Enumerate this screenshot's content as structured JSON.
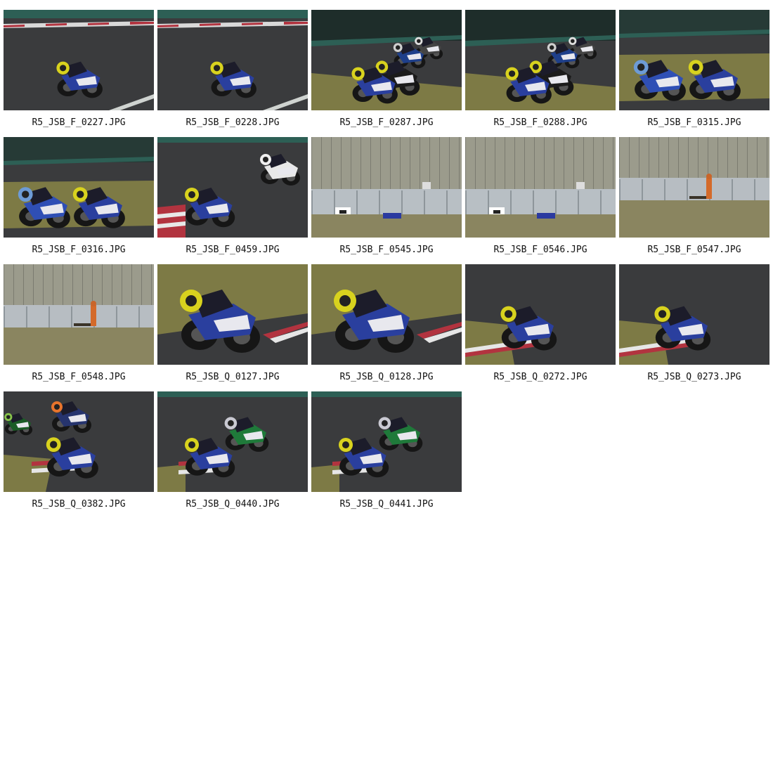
{
  "gallery": {
    "photos": [
      {
        "filename": "R5_JSB_F_0227.JPG",
        "scene": "track-single-rider"
      },
      {
        "filename": "R5_JSB_F_0228.JPG",
        "scene": "track-single-rider"
      },
      {
        "filename": "R5_JSB_F_0287.JPG",
        "scene": "grass-pack"
      },
      {
        "filename": "R5_JSB_F_0288.JPG",
        "scene": "grass-pack"
      },
      {
        "filename": "R5_JSB_F_0315.JPG",
        "scene": "grass-duo"
      },
      {
        "filename": "R5_JSB_F_0316.JPG",
        "scene": "grass-duo"
      },
      {
        "filename": "R5_JSB_F_0459.JPG",
        "scene": "kerb-duo"
      },
      {
        "filename": "R5_JSB_F_0545.JPG",
        "scene": "crash-barrier"
      },
      {
        "filename": "R5_JSB_F_0546.JPG",
        "scene": "crash-barrier"
      },
      {
        "filename": "R5_JSB_F_0547.JPG",
        "scene": "barrier-marshal"
      },
      {
        "filename": "R5_JSB_F_0548.JPG",
        "scene": "barrier-marshal"
      },
      {
        "filename": "R5_JSB_Q_0127.JPG",
        "scene": "grass-closeup"
      },
      {
        "filename": "R5_JSB_Q_0128.JPG",
        "scene": "grass-closeup"
      },
      {
        "filename": "R5_JSB_Q_0272.JPG",
        "scene": "kerb-single"
      },
      {
        "filename": "R5_JSB_Q_0273.JPG",
        "scene": "kerb-single"
      },
      {
        "filename": "R5_JSB_Q_0382.JPG",
        "scene": "kerb-chase"
      },
      {
        "filename": "R5_JSB_Q_0440.JPG",
        "scene": "kerb-chase-green"
      },
      {
        "filename": "R5_JSB_Q_0441.JPG",
        "scene": "kerb-chase-green"
      }
    ]
  },
  "colors": {
    "asphalt": "#3a3b3d",
    "grass": "#7d7a45",
    "wall": "#2d5f55",
    "kerb_red": "#b2333f",
    "bike_blue": "#2a3f9e",
    "helmet_yellow": "#d8d21e"
  }
}
